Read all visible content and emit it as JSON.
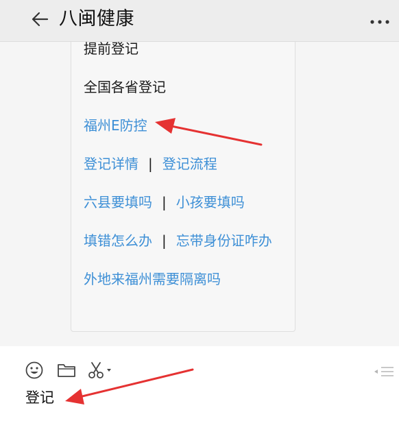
{
  "header": {
    "title": "八闽健康"
  },
  "menu": {
    "rows": [
      {
        "kind": "plain",
        "items": [
          "提前登记"
        ]
      },
      {
        "kind": "plain",
        "items": [
          "全国各省登记"
        ]
      },
      {
        "kind": "link",
        "items": [
          "福州E防控"
        ]
      },
      {
        "kind": "link",
        "items": [
          "登记详情",
          "登记流程"
        ]
      },
      {
        "kind": "link",
        "items": [
          "六县要填吗",
          "小孩要填吗"
        ]
      },
      {
        "kind": "link",
        "items": [
          "填错怎么办",
          "忘带身份证咋办"
        ]
      },
      {
        "kind": "link",
        "items": [
          "外地来福州需要隔离吗"
        ]
      }
    ],
    "separator": "|"
  },
  "input": {
    "value": "登记"
  },
  "colors": {
    "link": "#3d8fd6",
    "header_bg": "#ededed",
    "chat_bg": "#f5f5f5",
    "annotation_arrow": "#e53232"
  },
  "icons": {
    "back": "arrow-left-icon",
    "more": "more-dots-icon",
    "emoji": "smiley-icon",
    "folder": "folder-icon",
    "screenshot": "scissors-icon",
    "send": "send-lines-icon"
  }
}
